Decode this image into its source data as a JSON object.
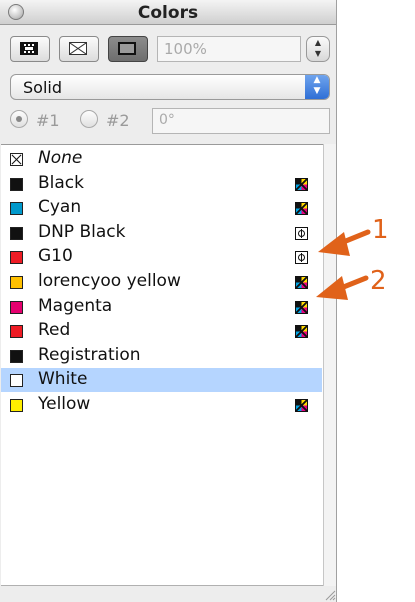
{
  "window": {
    "title": "Colors"
  },
  "toolbar": {
    "tint_value": "100%",
    "buttons": [
      "frame-color-button",
      "content-color-button",
      "text-color-button"
    ]
  },
  "blend": {
    "mode_label": "Solid"
  },
  "gradient": {
    "color1_label": "#1",
    "color2_label": "#2",
    "angle_value": "0°"
  },
  "colors_list": [
    {
      "name": "None",
      "swatch": "none",
      "model_icon": ""
    },
    {
      "name": "Black",
      "swatch": "#111111",
      "model_icon": "cmyk-icon"
    },
    {
      "name": "Cyan",
      "swatch": "#0099cc",
      "model_icon": "cmyk-icon"
    },
    {
      "name": "DNP Black",
      "swatch": "#111111",
      "model_icon": "spot-icon"
    },
    {
      "name": "G10",
      "swatch": "#ee1c25",
      "model_icon": "spot-icon"
    },
    {
      "name": "lorencyoo yellow",
      "swatch": "#ffc000",
      "model_icon": "cmyk-icon"
    },
    {
      "name": "Magenta",
      "swatch": "#e5006f",
      "model_icon": "cmyk-icon"
    },
    {
      "name": "Red",
      "swatch": "#ee1c25",
      "model_icon": "cmyk-icon"
    },
    {
      "name": "Registration",
      "swatch": "#111111",
      "model_icon": ""
    },
    {
      "name": "White",
      "swatch": "#ffffff",
      "model_icon": "",
      "selected": true
    },
    {
      "name": "Yellow",
      "swatch": "#ffee00",
      "model_icon": "cmyk-icon"
    }
  ],
  "callouts": [
    {
      "label": "1"
    },
    {
      "label": "2"
    }
  ],
  "colors": {
    "accent": "#e0621a",
    "selection": "#b5d5ff"
  }
}
